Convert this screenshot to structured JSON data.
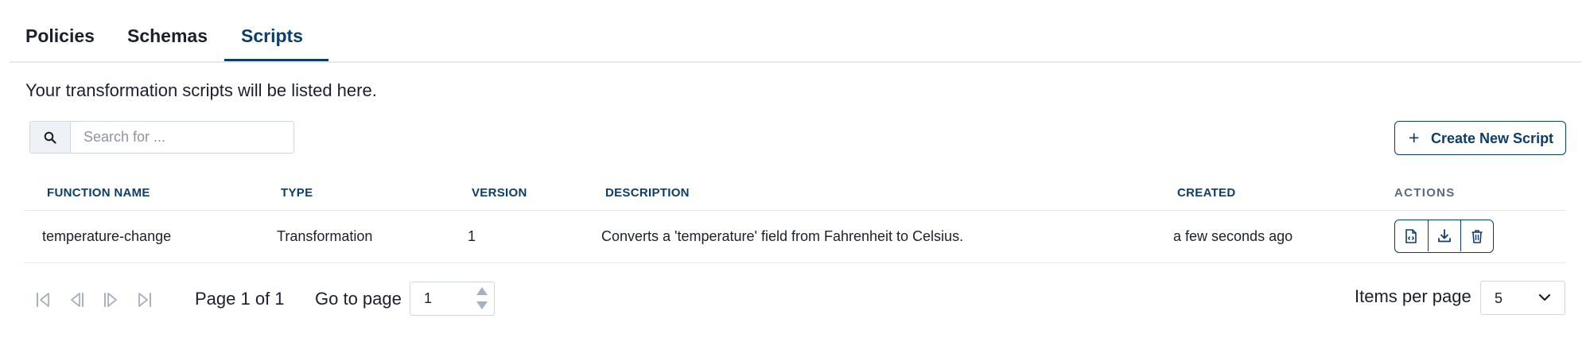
{
  "tabs": [
    {
      "label": "Policies"
    },
    {
      "label": "Schemas"
    },
    {
      "label": "Scripts"
    }
  ],
  "active_tab": "Scripts",
  "description": "Your transformation scripts will be listed here.",
  "search": {
    "placeholder": "Search for ...",
    "value": ""
  },
  "create_button": {
    "label": "Create New Script"
  },
  "table": {
    "columns": [
      "FUNCTION NAME",
      "TYPE",
      "VERSION",
      "DESCRIPTION",
      "CREATED",
      "ACTIONS"
    ],
    "rows": [
      {
        "function_name": "temperature-change",
        "type": "Transformation",
        "version": "1",
        "description": "Converts a 'temperature' field from Fahrenheit to Celsius.",
        "created": "a few seconds ago"
      }
    ]
  },
  "row_actions": [
    "file-code-icon",
    "download-icon",
    "trash-icon"
  ],
  "pagination": {
    "page_info": "Page 1 of 1",
    "go_to_label": "Go to page",
    "go_to_value": "1",
    "items_per_page_label": "Items per page",
    "items_per_page_value": "5"
  },
  "colors": {
    "accent": "#0d3d6b",
    "border": "#cfd6df",
    "divider": "#e6e9ee",
    "muted_icon": "#a5b1c2"
  }
}
